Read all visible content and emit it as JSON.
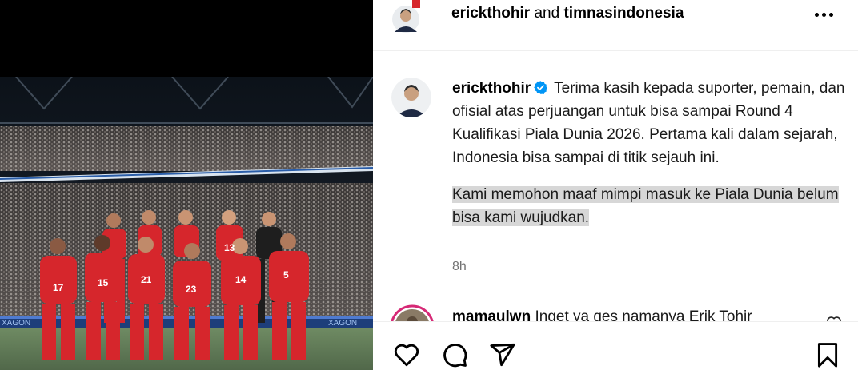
{
  "post": {
    "author": "erickthohir",
    "joiner": "and",
    "coauthor": "timnasindonesia"
  },
  "caption": {
    "username": "erickthohir",
    "paragraph1": "Terima kasih kepada suporter, pemain, dan ofisial atas perjuangan untuk bisa sampai Round 4 Kualifikasi Piala Dunia 2026. Pertama kali dalam sejarah, Indonesia bisa sampai di titik sejauh ini.",
    "paragraph2": "Kami memohon maaf mimpi masuk ke Piala Dunia belum bisa kami wujudkan.",
    "time": "8h"
  },
  "comment": {
    "username": "mamaulwn",
    "text": "Inget ya ges namanya Erik Tohir"
  },
  "icons": {
    "more": "more-horizontal-icon",
    "verified": "verified-badge-icon",
    "like": "heart-icon",
    "comment": "comment-icon",
    "share": "send-icon",
    "save": "bookmark-icon"
  },
  "colors": {
    "verified": "#0095f6",
    "highlight": "#d7d7d7",
    "muted": "#737373",
    "jersey": "#d6262c"
  }
}
